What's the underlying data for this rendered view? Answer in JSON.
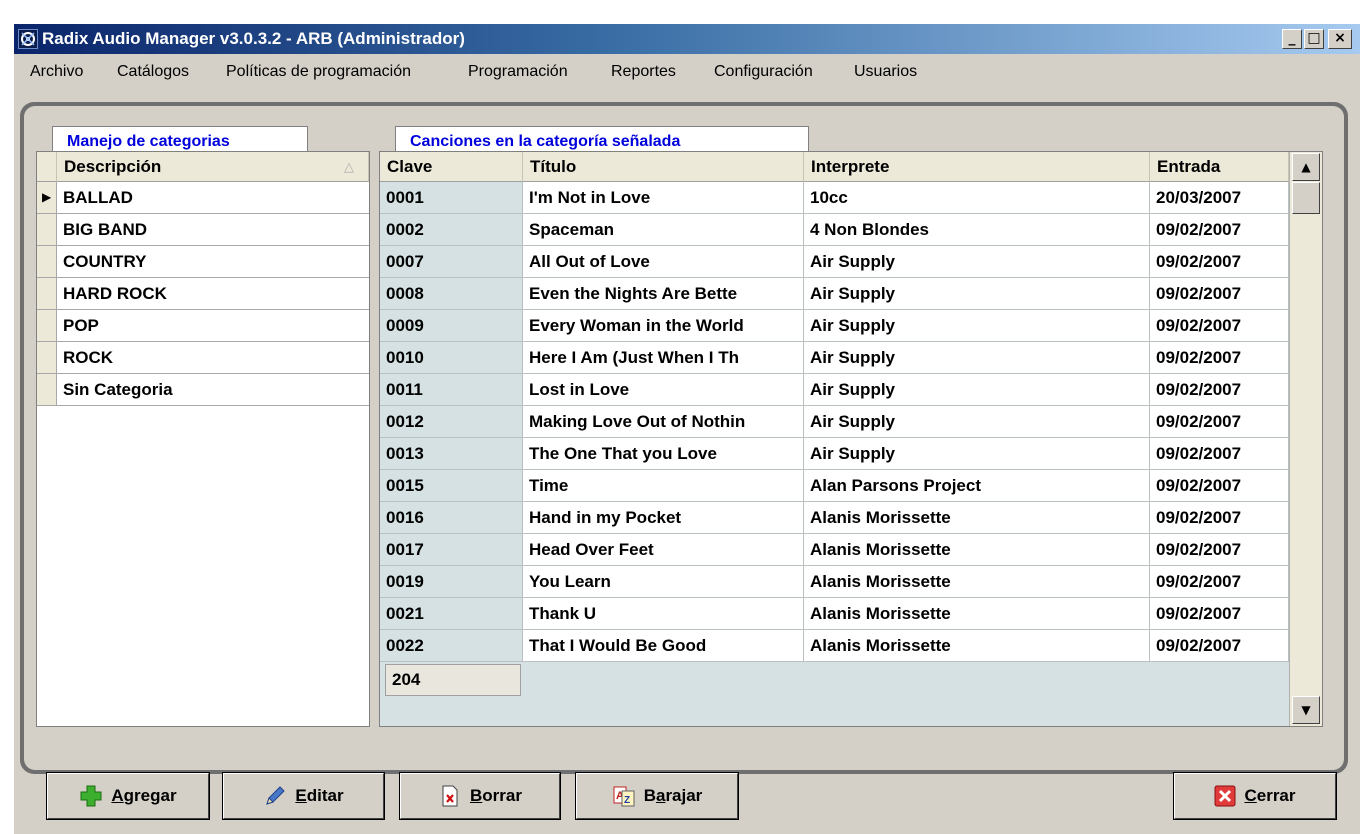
{
  "window": {
    "title": "Radix Audio Manager v3.0.3.2 - ARB (Administrador)",
    "controls": [
      "_",
      "□",
      "×"
    ]
  },
  "menu": [
    "Archivo",
    "Catálogos",
    "Políticas de programación",
    "Programación",
    "Reportes",
    "Configuración",
    "Usuarios"
  ],
  "left_tab": {
    "label": "Manejo de categorias"
  },
  "categories": {
    "header": "Descripción",
    "sort_indicator": "△",
    "selected_marker": "▶",
    "items": [
      "BALLAD",
      "BIG BAND",
      "COUNTRY",
      "HARD ROCK",
      "POP",
      "ROCK",
      "Sin Categoria"
    ]
  },
  "right_tab": {
    "label": "Canciones en la categoría señalada"
  },
  "songs": {
    "columns": [
      "Clave",
      "Título",
      "Interprete",
      "Entrada"
    ],
    "rows": [
      [
        "0001",
        "I'm Not in Love",
        "10cc",
        "20/03/2007"
      ],
      [
        "0002",
        "Spaceman",
        "4 Non Blondes",
        "09/02/2007"
      ],
      [
        "0007",
        "All Out of Love",
        "Air Supply",
        "09/02/2007"
      ],
      [
        "0008",
        "Even the Nights Are Bette",
        "Air Supply",
        "09/02/2007"
      ],
      [
        "0009",
        "Every Woman in the World",
        "Air Supply",
        "09/02/2007"
      ],
      [
        "0010",
        "Here I Am (Just When I Th",
        "Air Supply",
        "09/02/2007"
      ],
      [
        "0011",
        "Lost in Love",
        "Air Supply",
        "09/02/2007"
      ],
      [
        "0012",
        "Making Love Out of Nothin",
        "Air Supply",
        "09/02/2007"
      ],
      [
        "0013",
        "The One That you Love",
        "Air Supply",
        "09/02/2007"
      ],
      [
        "0015",
        "Time",
        "Alan Parsons Project",
        "09/02/2007"
      ],
      [
        "0016",
        "Hand in my Pocket",
        "Alanis Morissette",
        "09/02/2007"
      ],
      [
        "0017",
        "Head Over Feet",
        "Alanis Morissette",
        "09/02/2007"
      ],
      [
        "0019",
        "You Learn",
        "Alanis Morissette",
        "09/02/2007"
      ],
      [
        "0021",
        "Thank U",
        "Alanis Morissette",
        "09/02/2007"
      ],
      [
        "0022",
        "That I Would Be Good",
        "Alanis Morissette",
        "09/02/2007"
      ]
    ],
    "count": "204"
  },
  "buttons": {
    "agregar": {
      "underline": "A",
      "rest": "gregar",
      "icon": "green-plus-icon"
    },
    "editar": {
      "underline": "E",
      "rest": "ditar",
      "icon": "pen-icon"
    },
    "borrar": {
      "underline": "B",
      "rest": "orrar",
      "icon": "delete-document-icon"
    },
    "barajar": {
      "pre": "B",
      "underline": "a",
      "rest": "rajar",
      "icon": "shuffle-az-icon"
    },
    "cerrar": {
      "underline": "C",
      "rest": "errar",
      "icon": "red-x-icon"
    }
  },
  "colors": {
    "title_gradient_start": "#0a246a",
    "tab_label": "#0000dd",
    "clave_column": "#d6e1e3"
  }
}
